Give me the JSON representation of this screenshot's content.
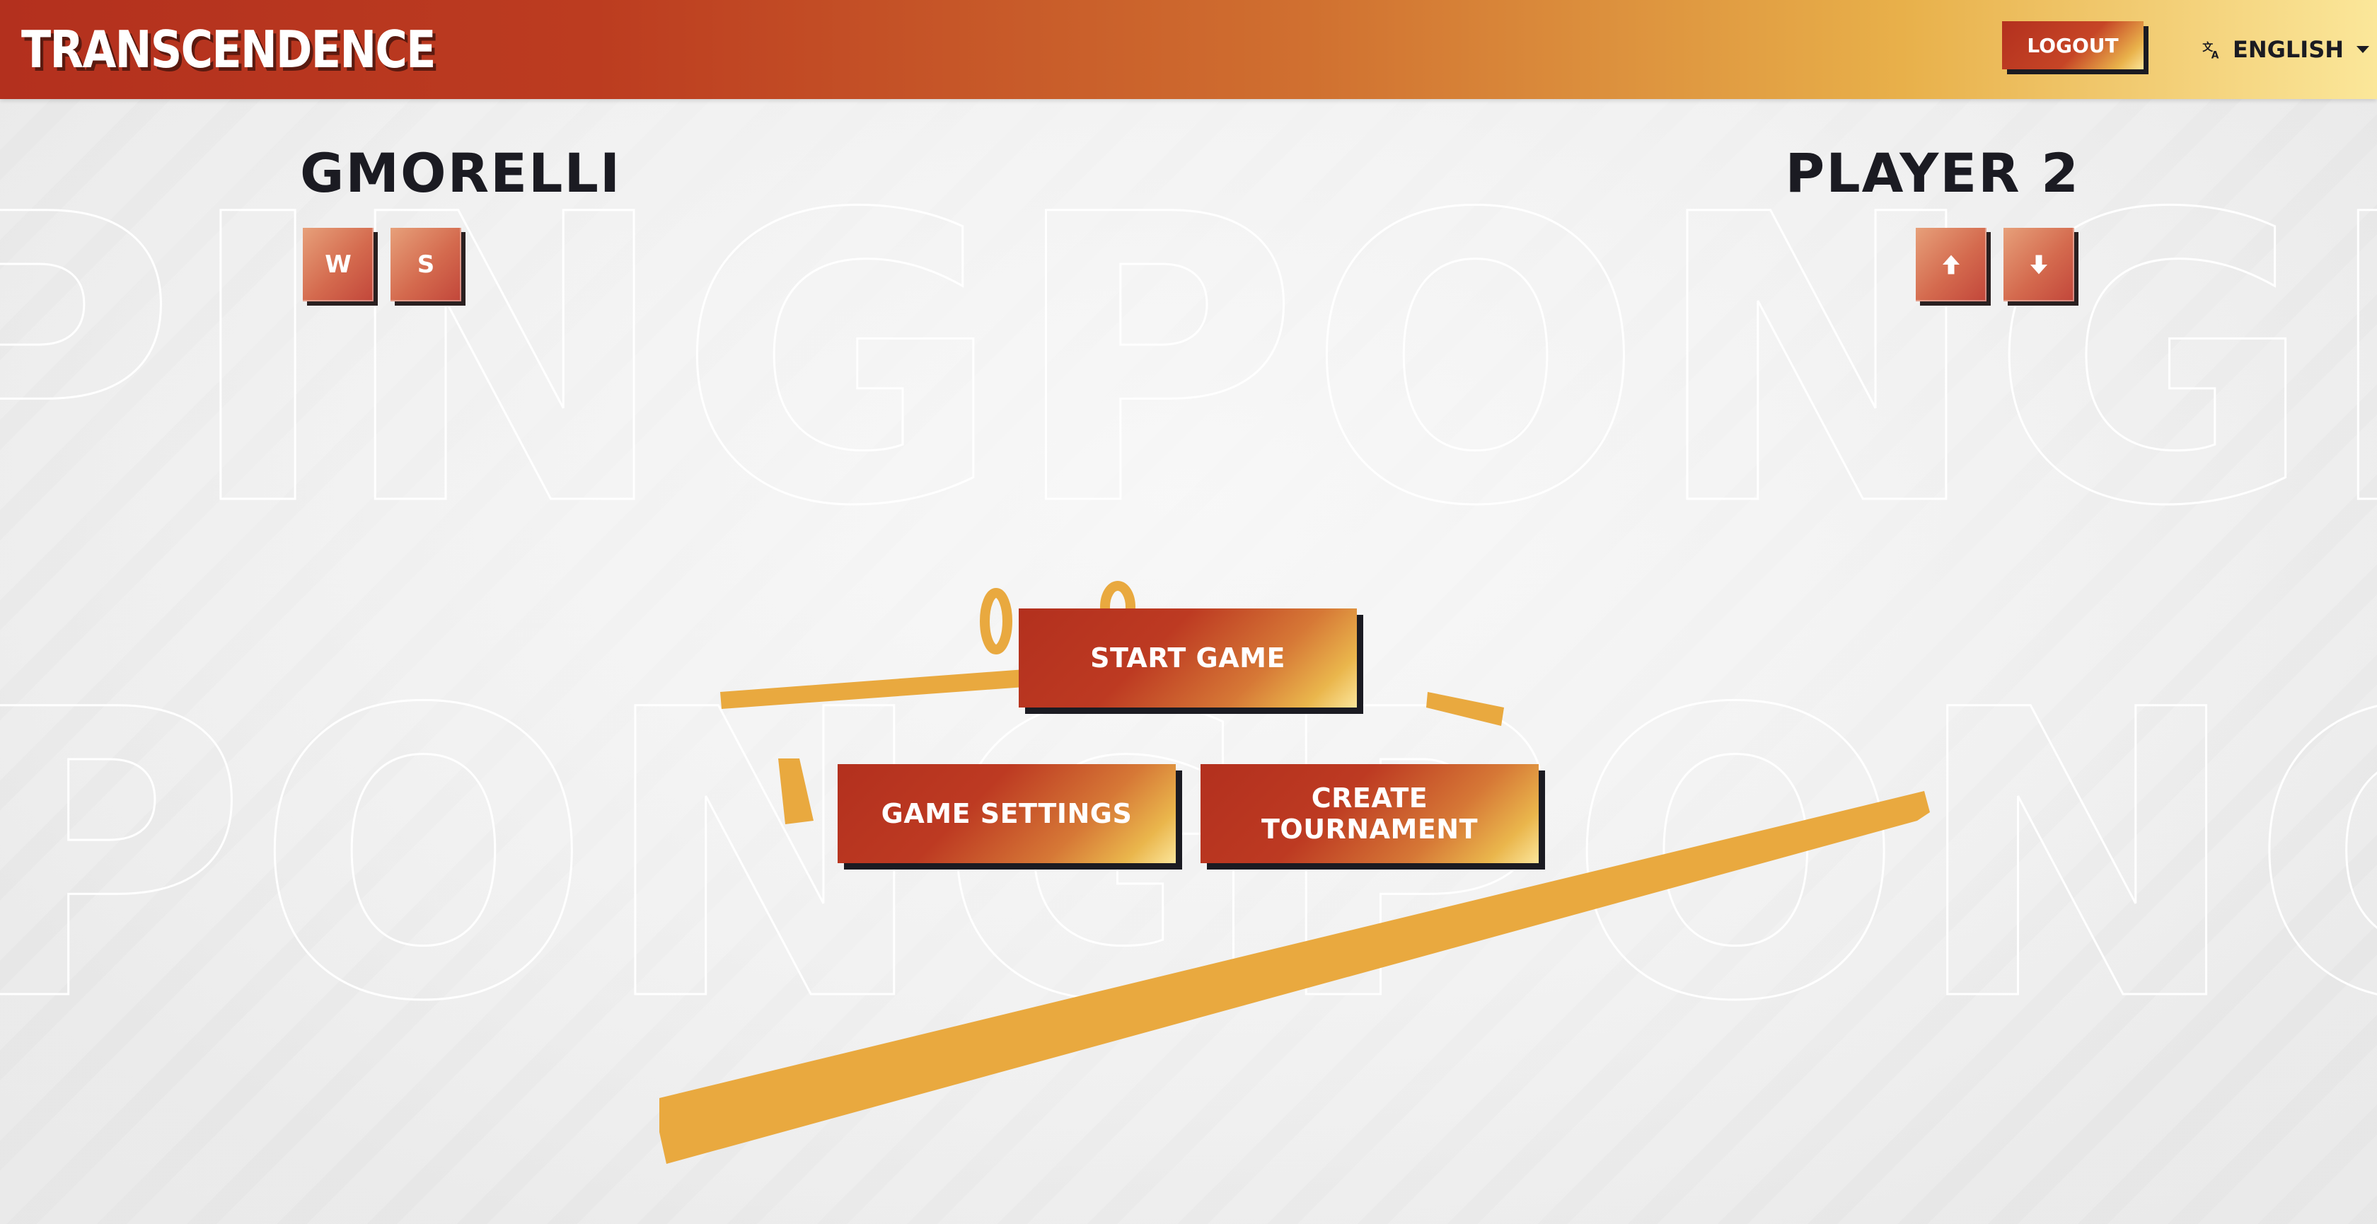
{
  "header": {
    "logo": "TRANSCENDENCE",
    "logout_label": "LOGOUT",
    "language": "ENGLISH",
    "language_icon": "translate-icon"
  },
  "players": {
    "left": {
      "name": "GMORELLI",
      "keys": [
        "W",
        "S"
      ]
    },
    "right": {
      "name": "PLAYER 2",
      "keys": [
        "arrow-up-icon",
        "arrow-down-icon"
      ]
    }
  },
  "background_text": {
    "row1": "PINGPONGPONG",
    "row2": "PONGPONGPONG"
  },
  "menu": {
    "start_label": "START GAME",
    "settings_label": "GAME SETTINGS",
    "tournament_label": "CREATE TOURNAMENT"
  },
  "colors": {
    "primary_red": "#b3301e",
    "accent_yellow": "#e9a93f",
    "dark": "#1b1b22"
  }
}
